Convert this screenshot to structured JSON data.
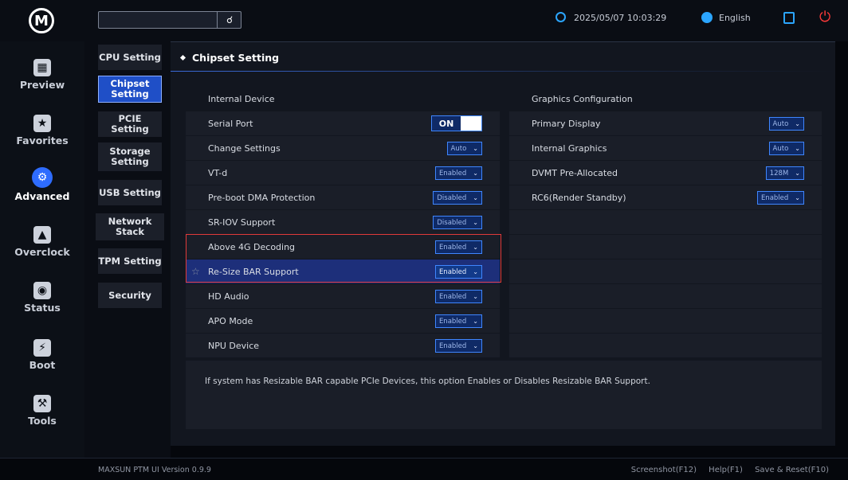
{
  "header": {
    "search_placeholder": "",
    "datetime": "2025/05/07 10:03:29",
    "language": "English"
  },
  "leftnav": {
    "items": [
      {
        "label": "Preview",
        "icon": "grid-icon"
      },
      {
        "label": "Favorites",
        "icon": "star-icon"
      },
      {
        "label": "Advanced",
        "icon": "wrench-icon"
      },
      {
        "label": "Overclock",
        "icon": "rocket-icon"
      },
      {
        "label": "Status",
        "icon": "status-icon"
      },
      {
        "label": "Boot",
        "icon": "boot-icon"
      },
      {
        "label": "Tools",
        "icon": "hammer-icon"
      }
    ]
  },
  "subnav": {
    "items": [
      {
        "label": "CPU Setting"
      },
      {
        "label": "Chipset\nSetting"
      },
      {
        "label": "PCIE Setting"
      },
      {
        "label": "Storage\nSetting"
      },
      {
        "label": "USB Setting"
      },
      {
        "label": "Network Stack"
      },
      {
        "label": "TPM Setting"
      },
      {
        "label": "Security"
      }
    ]
  },
  "main": {
    "title": "Chipset Setting",
    "left_header": "Internal Device",
    "left_rows": [
      {
        "label": "Serial Port",
        "value": "ON",
        "type": "toggle"
      },
      {
        "label": "Change Settings",
        "value": "Auto",
        "type": "select"
      },
      {
        "label": "VT-d",
        "value": "Enabled",
        "type": "select"
      },
      {
        "label": "Pre-boot DMA Protection",
        "value": "Disabled",
        "type": "select"
      },
      {
        "label": "SR-IOV Support",
        "value": "Disabled",
        "type": "select"
      },
      {
        "label": "Above 4G Decoding",
        "value": "Enabled",
        "type": "select"
      },
      {
        "label": "Re-Size BAR Support",
        "value": "Enabled",
        "type": "select"
      },
      {
        "label": "HD Audio",
        "value": "Enabled",
        "type": "select"
      },
      {
        "label": "APO Mode",
        "value": "Enabled",
        "type": "select"
      },
      {
        "label": "NPU Device",
        "value": "Enabled",
        "type": "select"
      }
    ],
    "right_header": "Graphics Configuration",
    "right_rows": [
      {
        "label": "Primary Display",
        "value": "Auto"
      },
      {
        "label": "Internal Graphics",
        "value": "Auto"
      },
      {
        "label": "DVMT Pre-Allocated",
        "value": "128M"
      },
      {
        "label": "RC6(Render Standby)",
        "value": "Enabled"
      }
    ],
    "help_text": "If system has Resizable BAR capable PCIe Devices, this option Enables or Disables Resizable BAR Support."
  },
  "footer": {
    "version": "MAXSUN PTM UI Version 0.9.9",
    "screenshot": "Screenshot(F12)",
    "help": "Help(F1)",
    "save_reset": "Save & Reset(F10)"
  },
  "colors": {
    "accent": "#2e6cff",
    "highlight_box": "#e03a3a",
    "selected_row": "#1d2f7a",
    "power": "#ff3a3a"
  }
}
